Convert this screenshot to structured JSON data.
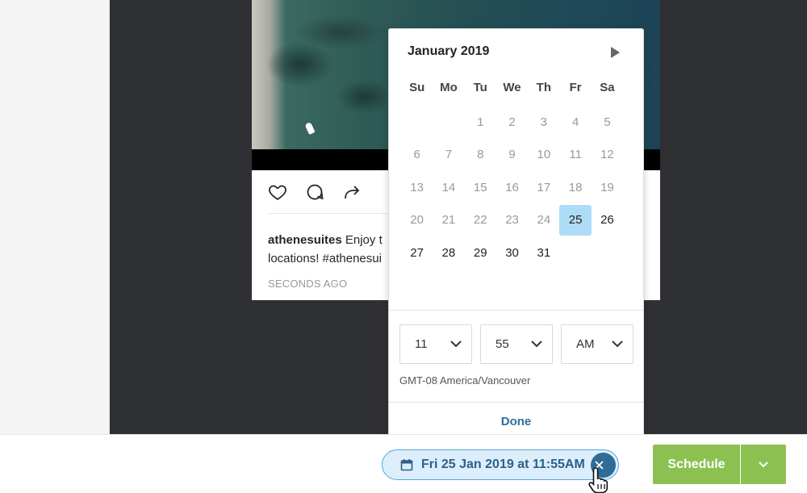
{
  "post": {
    "username": "athenesuites",
    "caption_line1": "Enjoy t",
    "caption_line2": "locations! #athenesui",
    "time": "SECONDS AGO"
  },
  "picker": {
    "month_label": "January 2019",
    "weekdays": [
      "Su",
      "Mo",
      "Tu",
      "We",
      "Th",
      "Fr",
      "Sa"
    ],
    "days": [
      {
        "label": "",
        "state": "empty"
      },
      {
        "label": "",
        "state": "empty"
      },
      {
        "label": "1",
        "state": "disabled"
      },
      {
        "label": "2",
        "state": "disabled"
      },
      {
        "label": "3",
        "state": "disabled"
      },
      {
        "label": "4",
        "state": "disabled"
      },
      {
        "label": "5",
        "state": "disabled"
      },
      {
        "label": "6",
        "state": "disabled"
      },
      {
        "label": "7",
        "state": "disabled"
      },
      {
        "label": "8",
        "state": "disabled"
      },
      {
        "label": "9",
        "state": "disabled"
      },
      {
        "label": "10",
        "state": "disabled"
      },
      {
        "label": "11",
        "state": "disabled"
      },
      {
        "label": "12",
        "state": "disabled"
      },
      {
        "label": "13",
        "state": "disabled"
      },
      {
        "label": "14",
        "state": "disabled"
      },
      {
        "label": "15",
        "state": "disabled"
      },
      {
        "label": "16",
        "state": "disabled"
      },
      {
        "label": "17",
        "state": "disabled"
      },
      {
        "label": "18",
        "state": "disabled"
      },
      {
        "label": "19",
        "state": "disabled"
      },
      {
        "label": "20",
        "state": "disabled"
      },
      {
        "label": "21",
        "state": "disabled"
      },
      {
        "label": "22",
        "state": "disabled"
      },
      {
        "label": "23",
        "state": "disabled"
      },
      {
        "label": "24",
        "state": "disabled"
      },
      {
        "label": "25",
        "state": "selected"
      },
      {
        "label": "26",
        "state": "available"
      },
      {
        "label": "27",
        "state": "available"
      },
      {
        "label": "28",
        "state": "available"
      },
      {
        "label": "29",
        "state": "available"
      },
      {
        "label": "30",
        "state": "available"
      },
      {
        "label": "31",
        "state": "available"
      }
    ],
    "hour": "11",
    "minute": "55",
    "ampm": "AM",
    "timezone": "GMT-08 America/Vancouver",
    "done_label": "Done"
  },
  "footer": {
    "date_chip": "Fri 25 Jan 2019 at 11:55AM",
    "schedule_label": "Schedule"
  },
  "colors": {
    "accent_green": "#8cc152",
    "selected_day": "#aedcf7",
    "link_blue": "#2e6f97"
  }
}
